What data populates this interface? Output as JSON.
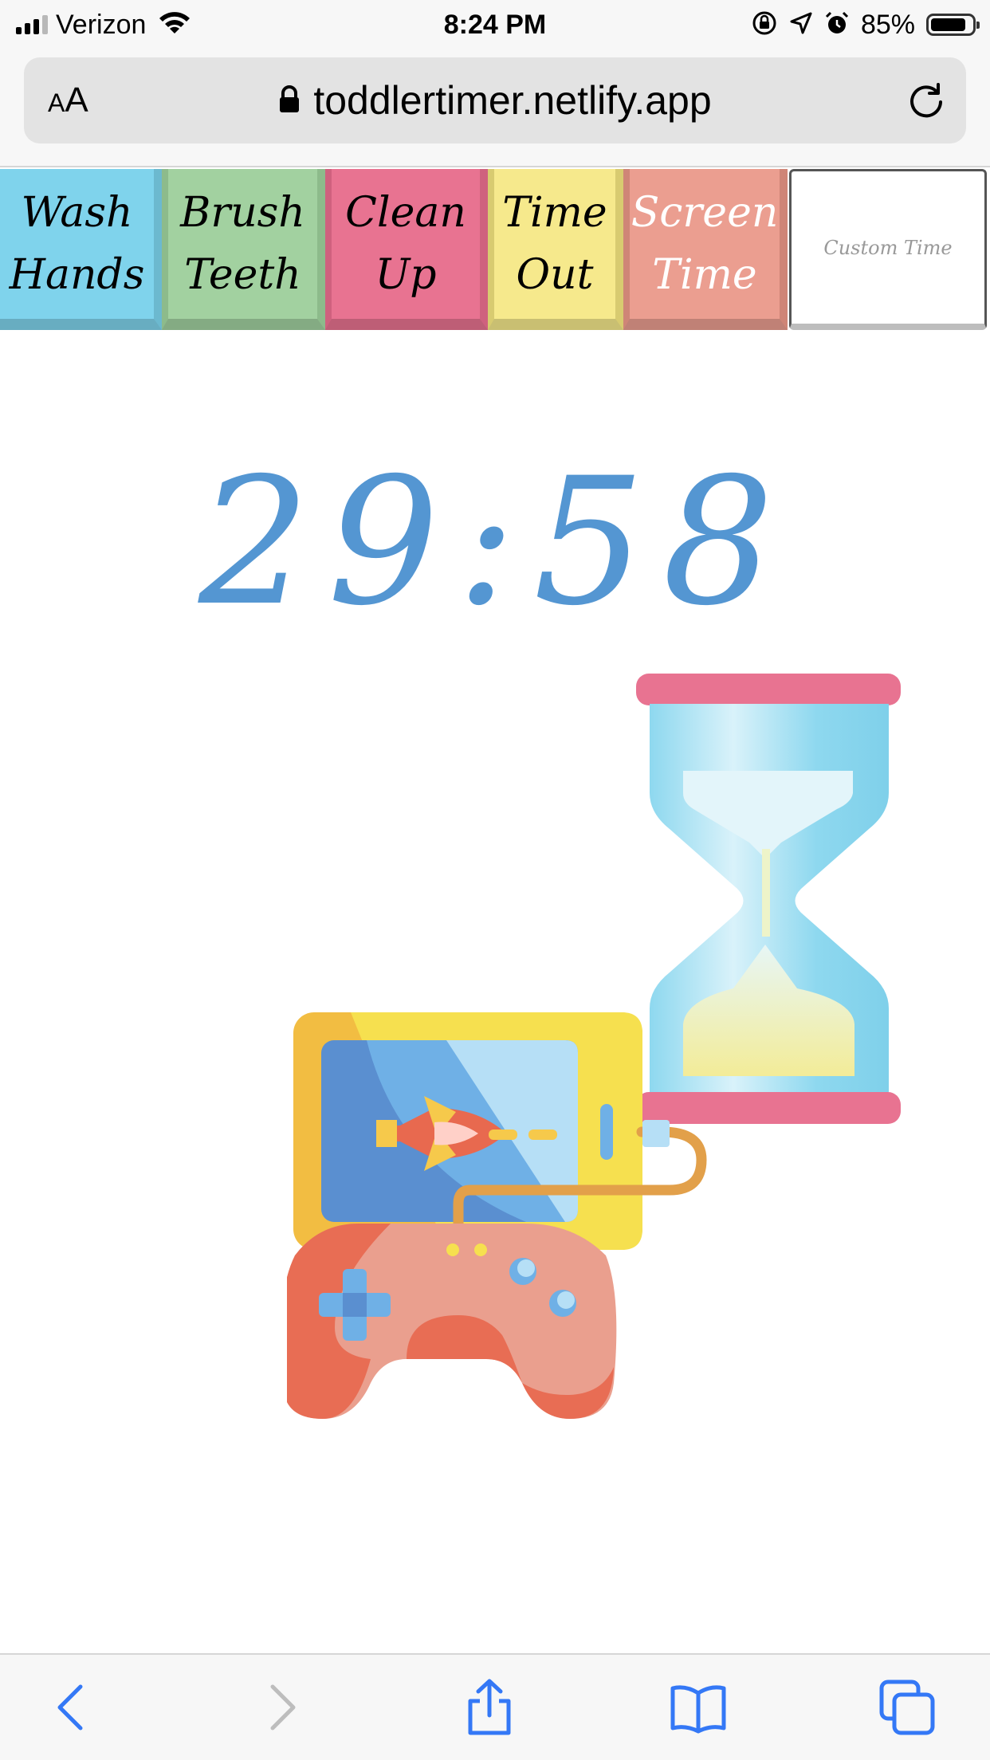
{
  "status_bar": {
    "carrier": "Verizon",
    "time": "8:24 PM",
    "battery_percent": "85%",
    "battery_level": 0.85,
    "signal_bars": 3,
    "icons": [
      "signal-icon",
      "wifi-icon",
      "rotation-lock-icon",
      "location-icon",
      "alarm-icon",
      "battery-icon"
    ]
  },
  "browser": {
    "text_size_label_small": "A",
    "text_size_label_large": "A",
    "url": "toddlertimer.netlify.app",
    "icons": [
      "lock-icon",
      "reload-icon"
    ]
  },
  "presets": [
    {
      "line1": "Wash",
      "line2": "Hands",
      "color": "#7fd3ec"
    },
    {
      "line1": "Brush",
      "line2": "Teeth",
      "color": "#a2d1a0"
    },
    {
      "line1": "Clean",
      "line2": "Up",
      "color": "#e87391"
    },
    {
      "line1": "Time",
      "line2": "Out",
      "color": "#f6e98c"
    },
    {
      "line1": "Screen",
      "line2": "Time",
      "color": "#eb9e90"
    }
  ],
  "custom_time": {
    "label": "Custom Time"
  },
  "timer": {
    "display": "29:58",
    "color": "#5496d2"
  },
  "illustration": {
    "icons": [
      "hourglass-icon",
      "tablet-icon",
      "game-controller-icon"
    ]
  },
  "toolbar": {
    "icons": [
      "back-icon",
      "forward-icon",
      "share-icon",
      "bookmarks-icon",
      "tabs-icon"
    ],
    "accent": "#3478f6"
  }
}
